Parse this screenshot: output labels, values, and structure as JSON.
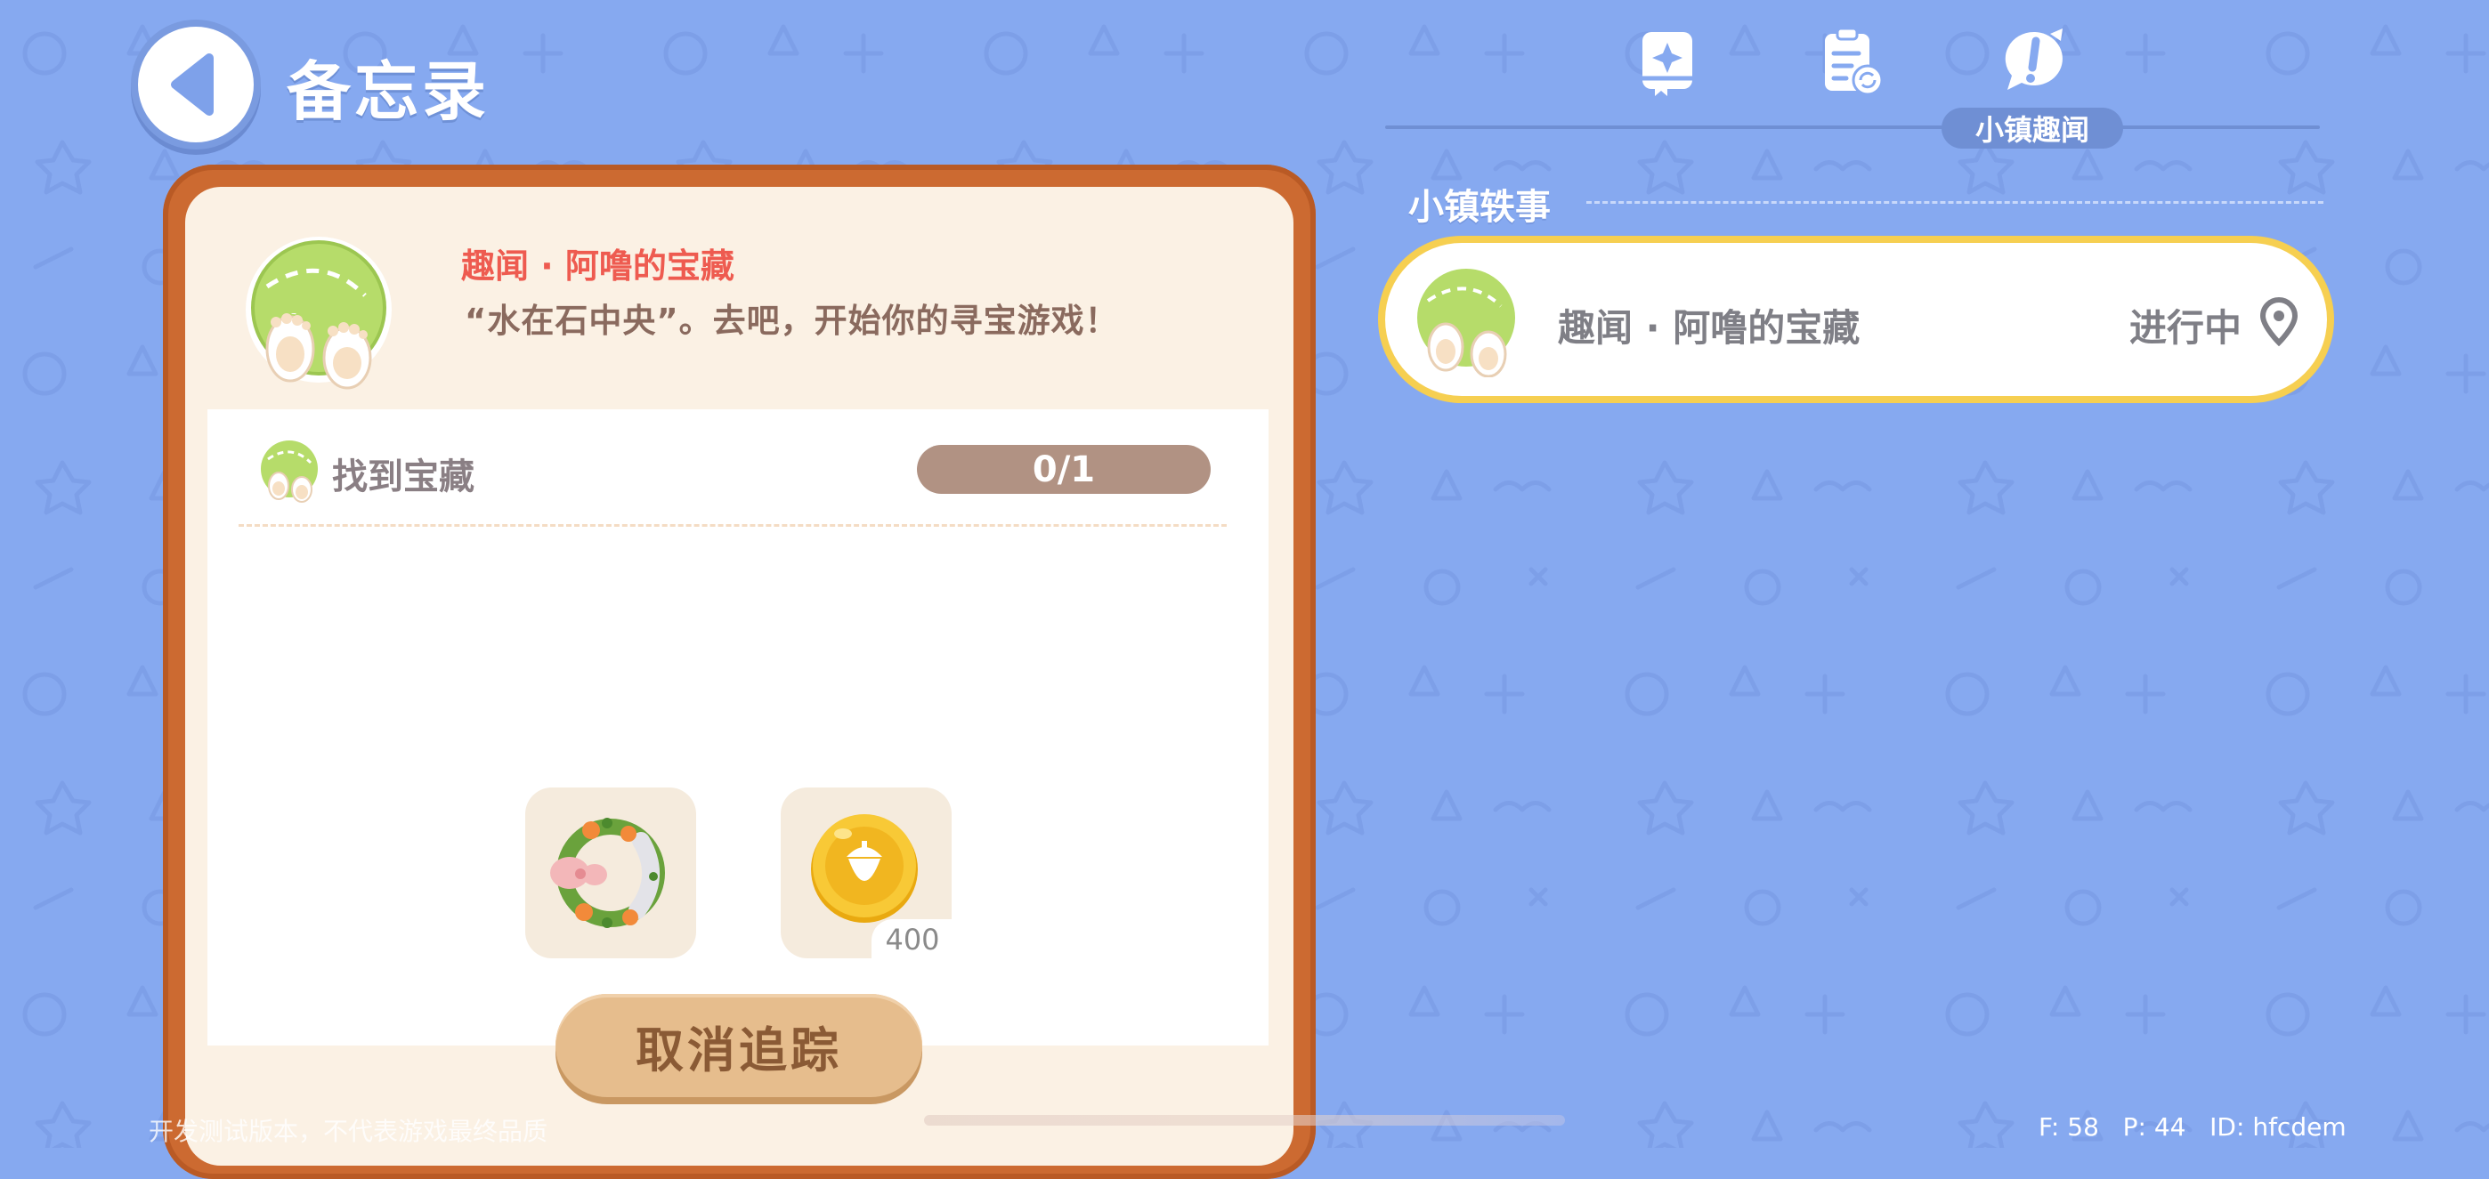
{
  "header": {
    "title": "备忘录",
    "back_icon": "back-arrow-icon"
  },
  "tabs": [
    {
      "name": "journal",
      "icon": "sparkle-book-icon",
      "active": false
    },
    {
      "name": "task-refresh",
      "icon": "clipboard-refresh-icon",
      "active": false
    },
    {
      "name": "town-tales",
      "icon": "exclamation-bubble-icon",
      "active": true,
      "label": "小镇趣闻"
    }
  ],
  "quest_detail": {
    "tag": "趣闻 · 阿噜的宝藏",
    "description": "“水在石中央”。去吧，开始你的寻宝游戏！",
    "goal": {
      "label": "找到宝藏",
      "progress_text": "0/1"
    },
    "rewards": [
      {
        "name": "flower-wreath",
        "icon": "wreath-icon",
        "count": ""
      },
      {
        "name": "acorn-coin",
        "icon": "acorn-coin-icon",
        "count": "400"
      }
    ],
    "action_button": "取消追踪"
  },
  "quest_list": {
    "section_title": "小镇轶事",
    "items": [
      {
        "name": "趣闻 · 阿噜的宝藏",
        "status": "进行中",
        "icon": "paw-globe-icon",
        "status_icon": "location-pin-icon"
      }
    ]
  },
  "footer": {
    "note": "开发测试版本，不代表游戏最终品质",
    "fps": "F: 58",
    "ping": "P: 44",
    "id": "ID: hfcdem"
  },
  "colors": {
    "background": "#86a9f0",
    "card_border": "#cc6a31",
    "card_fill": "#fbf1e4",
    "tag_red": "#ee5b50",
    "progress_fill": "#b19283",
    "button_fill": "#e6bd8d",
    "highlight_border": "#f6cf51"
  }
}
